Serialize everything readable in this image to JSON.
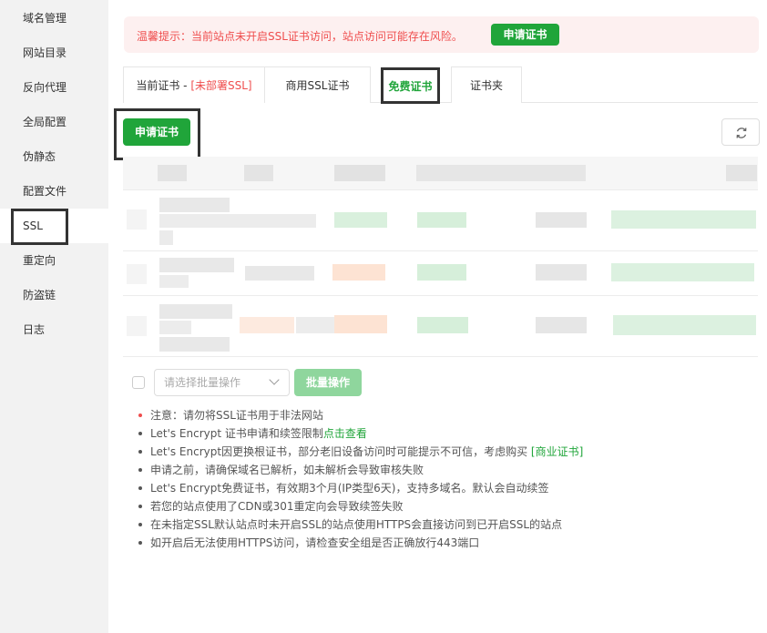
{
  "sidebar": {
    "items": [
      {
        "label": "域名管理"
      },
      {
        "label": "网站目录"
      },
      {
        "label": "反向代理"
      },
      {
        "label": "全局配置"
      },
      {
        "label": "伪静态"
      },
      {
        "label": "配置文件"
      },
      {
        "label": "SSL"
      },
      {
        "label": "重定向"
      },
      {
        "label": "防盗链"
      },
      {
        "label": "日志"
      }
    ],
    "active": "SSL"
  },
  "alert": {
    "text": "温馨提示：当前站点未开启SSL证书访问，站点访问可能存在风险。",
    "button_label": "申请证书"
  },
  "tabs": {
    "current_prefix": "当前证书 - ",
    "current_status": "[未部署SSL]",
    "commercial": "商用SSL证书",
    "free": "免费证书",
    "folder": "证书夹"
  },
  "toolbar": {
    "apply_label": "申请证书",
    "refresh_icon": "refresh-icon"
  },
  "batch": {
    "select_placeholder": "请选择批量操作",
    "button_label": "批量操作"
  },
  "notes": {
    "n1": "注意：请勿将SSL证书用于非法网站",
    "n2_prefix": "Let's Encrypt 证书申请和续签限制",
    "n2_link": "点击查看",
    "n3_prefix": "Let's Encrypt因更换根证书，部分老旧设备访问时可能提示不可信，考虑购买 ",
    "n3_link": "[商业证书]",
    "n4": "申请之前，请确保域名已解析，如未解析会导致审核失败",
    "n5": "Let's Encrypt免费证书，有效期3个月(IP类型6天)，支持多域名。默认会自动续签",
    "n6": "若您的站点使用了CDN或301重定向会导致续签失败",
    "n7": "在未指定SSL默认站点时未开启SSL的站点使用HTTPS会直接访问到已开启SSL的站点",
    "n8": "如开启后无法使用HTTPS访问，请检查安全组是否正确放行443端口"
  },
  "colors": {
    "accent": "#20a53a",
    "danger": "#ef4d4d",
    "sidebar_bg": "#f2f2f2"
  }
}
